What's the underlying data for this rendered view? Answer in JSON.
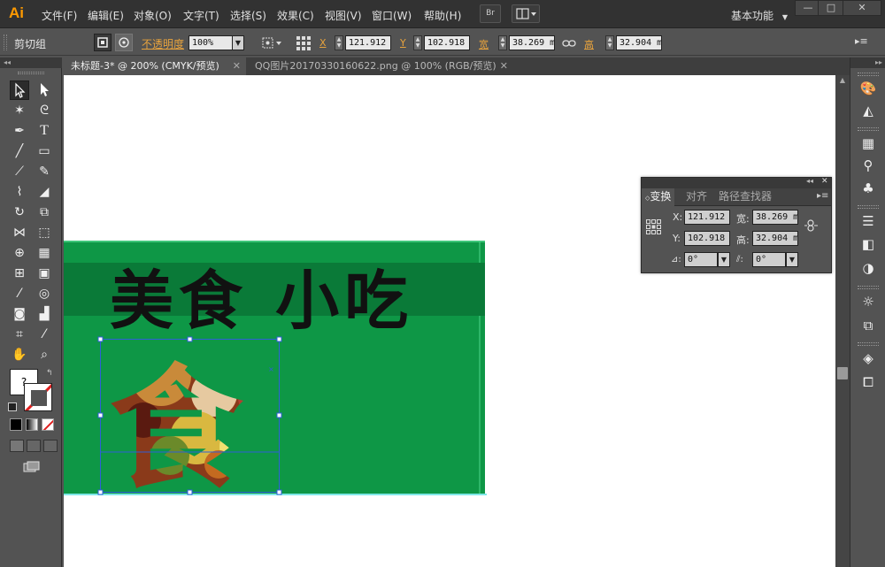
{
  "app": {
    "logo": "Ai",
    "menu": [
      "文件(F)",
      "编辑(E)",
      "对象(O)",
      "文字(T)",
      "选择(S)",
      "效果(C)",
      "视图(V)",
      "窗口(W)",
      "帮助(H)"
    ],
    "bridge_label": "Br",
    "workspace": "基本功能",
    "window_controls": [
      "—",
      "□",
      "✕"
    ]
  },
  "control_bar": {
    "selection_type": "剪切组",
    "opacity_label": "不透明度",
    "opacity_value": "100%",
    "x_label": "X",
    "x_value": "121.912 r",
    "y_label": "Y",
    "y_value": "102.918 r",
    "w_label": "宽",
    "w_value": "38.269 mi",
    "h_label": "高",
    "h_value": "32.904 mi"
  },
  "tabs": [
    {
      "label": "未标题-3* @ 200% (CMYK/预览)",
      "active": true
    },
    {
      "label": "QQ图片20170330160622.png @ 100% (RGB/预览)",
      "active": false
    }
  ],
  "artwork": {
    "headline": "美食 小吃",
    "clipped_glyph": "食",
    "banner_color": "#0e9746",
    "stripe_color": "#0a7a38"
  },
  "transform_panel": {
    "tabs": [
      "变换",
      "对齐",
      "路径查找器"
    ],
    "x_label": "X:",
    "x_value": "121.912",
    "y_label": "Y:",
    "y_value": "102.918",
    "w_label": "宽:",
    "w_value": "38.269 m",
    "h_label": "高:",
    "h_value": "32.904 m",
    "angle_value": "0°",
    "shear_value": "0°"
  },
  "toolbar": {
    "fill_label": "?"
  },
  "colors": {
    "accent": "#e8a33d",
    "logo": "#ff9a00",
    "ui_bg": "#535353",
    "menubar_bg": "#323232",
    "selection_blue": "#2f5fd8"
  }
}
